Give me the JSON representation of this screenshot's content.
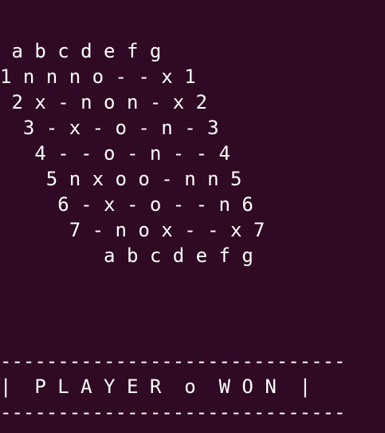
{
  "terminal": {
    "background_color": "#300a24",
    "text_color": "#ffffff",
    "board": {
      "header": " a b c d e f g",
      "rows": [
        "1 n n n o - - x 1",
        " 2 x - n o n - x 2",
        "  3 - x - o - n - 3",
        "   4 - - o - n - - 4",
        "    5 n x o o - n n 5",
        "     6 - x - o - - n 6",
        "      7 - n o x - - x 7"
      ],
      "footer": "         a b c d e f g"
    },
    "result_banner": {
      "border_top": "------------------------------",
      "message": "|  P L A Y E R  o  W O N  |",
      "border_bottom": "------------------------------"
    }
  }
}
